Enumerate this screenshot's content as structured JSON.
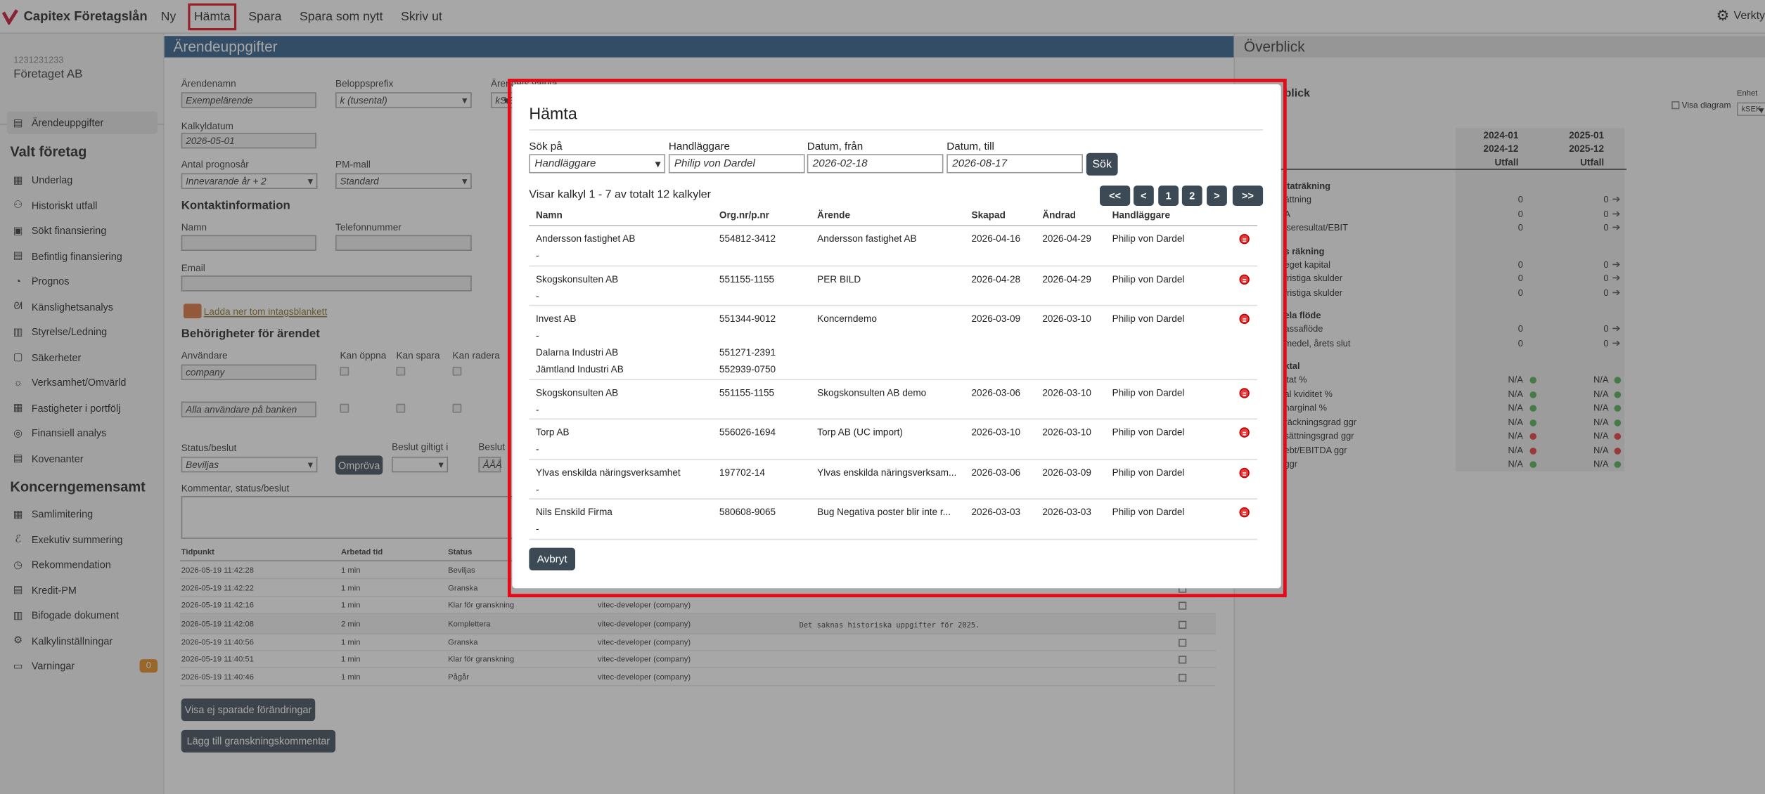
{
  "app": {
    "title": "Capitex Företagslån",
    "menu": [
      "Ny",
      "Hämta",
      "Spara",
      "Spara som nytt",
      "Skriv ut"
    ],
    "tools_label": "Verkty"
  },
  "account": {
    "id": "1231231233",
    "name": "Företaget AB"
  },
  "sidebar": {
    "top_item": "Ärendeuppgifter",
    "section1": "Valt företag",
    "items1": [
      "Underlag",
      "Historiskt utfall",
      "Sökt finansiering",
      "Befintlig finansiering",
      "Prognos",
      "Känslighetsanalys",
      "Styrelse/Ledning",
      "Säkerheter",
      "Verksamhet/Omvärld",
      "Fastigheter i portfölj",
      "Finansiell analys",
      "Kovenanter"
    ],
    "section2": "Koncerngemensamt",
    "items2": [
      "Samlimitering",
      "Exekutiv summering",
      "Rekommendation",
      "Kredit-PM",
      "Bifogade dokument",
      "Kalkylinställningar",
      "Varningar"
    ],
    "warnings_count": "0"
  },
  "main": {
    "header": "Ärendeuppgifter",
    "arendenamn_label": "Ärendenamn",
    "arendenamn_value": "Exempelärende",
    "beloppsprefix_label": "Beloppsprefix",
    "beloppsprefix_value": "k (tusental)",
    "valuta_label": "Ärendets valuta",
    "valuta_value": "kSE",
    "kalkyldatum_label": "Kalkyldatum",
    "kalkyldatum_value": "2026-05-01",
    "prognosar_label": "Antal prognosår",
    "prognosar_value": "Innevarande år + 2",
    "pmmall_label": "PM-mall",
    "pmmall_value": "Standard",
    "kontakt_heading": "Kontaktinformation",
    "namn_label": "Namn",
    "telefon_label": "Telefonnummer",
    "email_label": "Email",
    "download_link": "Ladda ner tom intagsblankett",
    "behorigheter_heading": "Behörigheter för ärendet",
    "anvandare_label": "Användare",
    "kan_oppna": "Kan öppna",
    "kan_spara": "Kan spara",
    "kan_radera": "Kan radera",
    "anvandare_value": "company",
    "alla_value": "Alla användare på banken",
    "status_label": "Status/beslut",
    "status_value": "Beviljas",
    "ompröva": "Ompröva",
    "beslut_giltigt_label": "Beslut giltigt i",
    "beslut_label": "Beslut",
    "beslut_placeholder": "ÅÅÅ",
    "kommentar_label": "Kommentar, status/beslut",
    "log_headers": [
      "Tidpunkt",
      "Arbetad tid",
      "Status"
    ],
    "log_rows": [
      [
        "2026-05-19 11:42:28",
        "1 min",
        "Beviljas",
        "",
        ""
      ],
      [
        "2026-05-19 11:42:22",
        "1 min",
        "Granska",
        "",
        ""
      ],
      [
        "2026-05-19 11:42:16",
        "1 min",
        "Klar för granskning",
        "vitec-developer (company)",
        ""
      ],
      [
        "2026-05-19 11:42:08",
        "2 min",
        "Komplettera",
        "vitec-developer (company)",
        "Det saknas historiska uppgifter för 2025."
      ],
      [
        "2026-05-19 11:40:56",
        "1 min",
        "Granska",
        "vitec-developer (company)",
        ""
      ],
      [
        "2026-05-19 11:40:51",
        "1 min",
        "Klar för granskning",
        "vitec-developer (company)",
        ""
      ],
      [
        "2026-05-19 11:40:46",
        "1 min",
        "Pågår",
        "vitec-developer (company)",
        ""
      ]
    ],
    "btn_visa": "Visa ej sparade förändringar",
    "btn_lagg": "Lägg till granskningskommentar"
  },
  "right": {
    "header": "Överblick",
    "sub": "blick",
    "enhet_label": "Enhet",
    "enhet_value": "kSEK",
    "visa_diagram": "Visa diagram",
    "col1": [
      "2024-01",
      "2024-12",
      "Utfall"
    ],
    "col2": [
      "2025-01",
      "2025-12",
      "Utfall"
    ],
    "rows": [
      {
        "t": "h",
        "label": "ltaträkning"
      },
      {
        "t": "r",
        "label": "ättning",
        "a": "0",
        "b": "0"
      },
      {
        "t": "r",
        "label": "A",
        "a": "0",
        "b": "0"
      },
      {
        "t": "r",
        "label": "iseresultat/EBIT",
        "a": "0",
        "b": "0"
      },
      {
        "t": "h",
        "label": "s räkning"
      },
      {
        "t": "r",
        "label": "eget kapital",
        "a": "0",
        "b": "0"
      },
      {
        "t": "r",
        "label": "fristiga skulder",
        "a": "0",
        "b": "0"
      },
      {
        "t": "r",
        "label": "fristiga skulder",
        "a": "0",
        "b": "0"
      },
      {
        "t": "h",
        "label": "ela flöde"
      },
      {
        "t": "r",
        "label": "assaflöde",
        "a": "0",
        "b": "0"
      },
      {
        "t": "r",
        "label": "medel, årets slut",
        "a": "0",
        "b": "0"
      },
      {
        "t": "h",
        "label": "ktal"
      },
      {
        "t": "k",
        "label": "itat %",
        "a": "N/A",
        "b": "N/A",
        "ca": "#4caf50",
        "cb": "#4caf50"
      },
      {
        "t": "k",
        "label": "al kviditet %",
        "a": "N/A",
        "b": "N/A",
        "ca": "#4caf50",
        "cb": "#4caf50"
      },
      {
        "t": "k",
        "label": "narginal %",
        "a": "N/A",
        "b": "N/A",
        "ca": "#4caf50",
        "cb": "#4caf50"
      },
      {
        "t": "k",
        "label": "räckningsgrad ggr",
        "a": "N/A",
        "b": "N/A",
        "ca": "#4caf50",
        "cb": "#4caf50"
      },
      {
        "t": "k",
        "label": "sättningsgrad ggr",
        "a": "N/A",
        "b": "N/A",
        "ca": "#e53935",
        "cb": "#e53935"
      },
      {
        "t": "k",
        "label": "ebt/EBITDA ggr",
        "a": "N/A",
        "b": "N/A",
        "ca": "#e53935",
        "cb": "#e53935"
      },
      {
        "t": "k",
        "label": "ggr",
        "a": "N/A",
        "b": "N/A",
        "ca": "#4caf50",
        "cb": "#4caf50"
      }
    ]
  },
  "dialog": {
    "title": "Hämta",
    "sok_pa_label": "Sök på",
    "sok_pa_value": "Handläggare",
    "handlaggare_label": "Handläggare",
    "handlaggare_value": "Philip von Dardel",
    "datum_fran_label": "Datum, från",
    "datum_fran_value": "2026-02-18",
    "datum_till_label": "Datum, till",
    "datum_till_value": "2026-08-17",
    "sok_button": "Sök",
    "showing": "Visar kalkyl 1 - 7 av totalt 12 kalkyler",
    "pager": [
      "<<",
      "<",
      "1",
      "2",
      ">",
      ">>"
    ],
    "headers": [
      "Namn",
      "Org.nr/p.nr",
      "Ärende",
      "Skapad",
      "Ändrad",
      "Handläggare"
    ],
    "rows": [
      {
        "name": "Andersson fastighet AB",
        "org": "554812-3412",
        "arende": "Andersson fastighet AB",
        "skapad": "2026-04-16",
        "andrad": "2026-04-29",
        "handl": "Philip von Dardel",
        "sub": "-",
        "extra": []
      },
      {
        "name": "Skogskonsulten AB",
        "org": "551155-1155",
        "arende": "PER BILD",
        "skapad": "2026-04-28",
        "andrad": "2026-04-29",
        "handl": "Philip von Dardel",
        "sub": "-",
        "extra": []
      },
      {
        "name": "Invest AB",
        "org": "551344-9012",
        "arende": "Koncerndemo",
        "skapad": "2026-03-09",
        "andrad": "2026-03-10",
        "handl": "Philip von Dardel",
        "sub": "-",
        "extra": [
          [
            "Dalarna Industri AB",
            "551271-2391"
          ],
          [
            "Jämtland Industri AB",
            "552939-0750"
          ]
        ]
      },
      {
        "name": "Skogskonsulten AB",
        "org": "551155-1155",
        "arende": "Skogskonsulten AB demo",
        "skapad": "2026-03-06",
        "andrad": "2026-03-10",
        "handl": "Philip von Dardel",
        "sub": "-",
        "extra": []
      },
      {
        "name": "Torp AB",
        "org": "556026-1694",
        "arende": "Torp AB (UC import)",
        "skapad": "2026-03-10",
        "andrad": "2026-03-10",
        "handl": "Philip von Dardel",
        "sub": "-",
        "extra": []
      },
      {
        "name": "Ylvas enskilda näringsverksamhet",
        "org": "197702-14",
        "arende": "Ylvas enskilda näringsverksam...",
        "skapad": "2026-03-06",
        "andrad": "2026-03-09",
        "handl": "Philip von Dardel",
        "sub": "-",
        "extra": []
      },
      {
        "name": "Nils Enskild Firma",
        "org": "580608-9065",
        "arende": "Bug Negativa poster blir inte r...",
        "skapad": "2026-03-03",
        "andrad": "2026-03-03",
        "handl": "Philip von Dardel",
        "sub": "-",
        "extra": []
      }
    ],
    "cancel_button": "Avbryt"
  }
}
